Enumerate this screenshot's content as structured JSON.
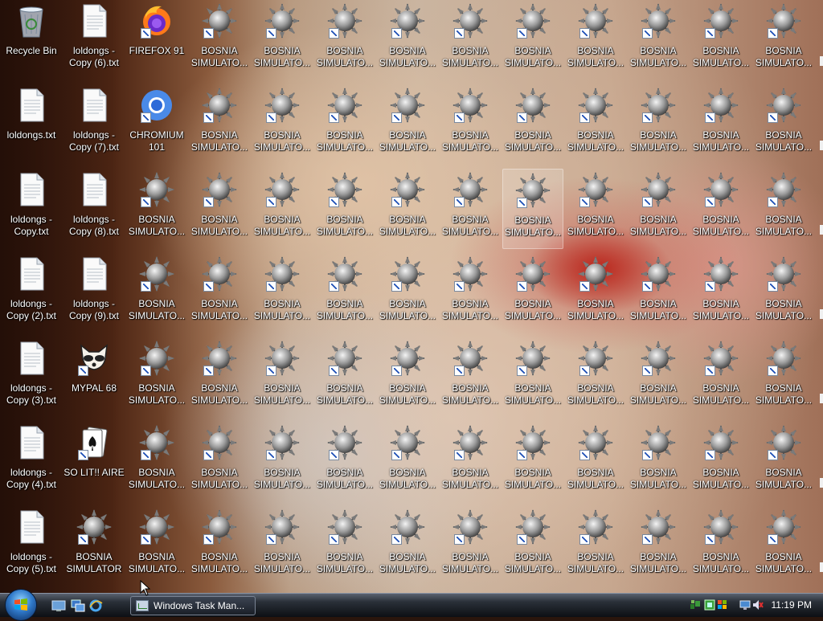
{
  "desktop": {
    "system_icons": [
      {
        "name": "recycle-bin",
        "label": "Recycle Bin",
        "type": "recycle"
      },
      {
        "name": "txt-copy-6",
        "label": "loldongs -\nCopy (6).txt",
        "type": "txt"
      },
      {
        "name": "firefox",
        "label": "FIREFOX 91",
        "type": "firefox"
      },
      {
        "name": "txt-loldongs",
        "label": "loldongs.txt",
        "type": "txt"
      },
      {
        "name": "txt-copy-7",
        "label": "loldongs -\nCopy (7).txt",
        "type": "txt"
      },
      {
        "name": "chromium",
        "label": "CHROMIUM\n101",
        "type": "chromium"
      },
      {
        "name": "txt-copy",
        "label": "loldongs -\nCopy.txt",
        "type": "txt"
      },
      {
        "name": "txt-copy-8",
        "label": "loldongs -\nCopy (8).txt",
        "type": "txt"
      },
      {
        "name": "txt-copy-2",
        "label": "loldongs -\nCopy (2).txt",
        "type": "txt"
      },
      {
        "name": "txt-copy-9",
        "label": "loldongs -\nCopy (9).txt",
        "type": "txt"
      },
      {
        "name": "txt-copy-3",
        "label": "loldongs -\nCopy (3).txt",
        "type": "txt"
      },
      {
        "name": "mypal",
        "label": "MYPAL 68",
        "type": "mypal"
      },
      {
        "name": "txt-copy-4",
        "label": "loldongs -\nCopy (4).txt",
        "type": "txt"
      },
      {
        "name": "solitaire",
        "label": "SO LIT!! AIRE",
        "type": "cards"
      },
      {
        "name": "txt-copy-5",
        "label": "loldongs -\nCopy (5).txt",
        "type": "txt"
      },
      {
        "name": "bosnia-simulator-main",
        "label": "BOSNIA\nSIMULATOR",
        "type": "mine"
      }
    ],
    "shortcut_label": "BOSNIA\nSIMULATO...",
    "shortcut_count": 79,
    "selected_shortcut": "row 3, col 7"
  },
  "taskbar": {
    "start": "start-orb",
    "quick_launch": [
      "show-desktop-icon",
      "switch-windows-icon",
      "internet-explorer-icon"
    ],
    "task_button": "Windows Task Man...",
    "tray_icons": [
      "network-icon",
      "green-app-icon",
      "windows-icon",
      "display-icon",
      "volume-muted-icon"
    ],
    "clock": "11:19 PM"
  }
}
